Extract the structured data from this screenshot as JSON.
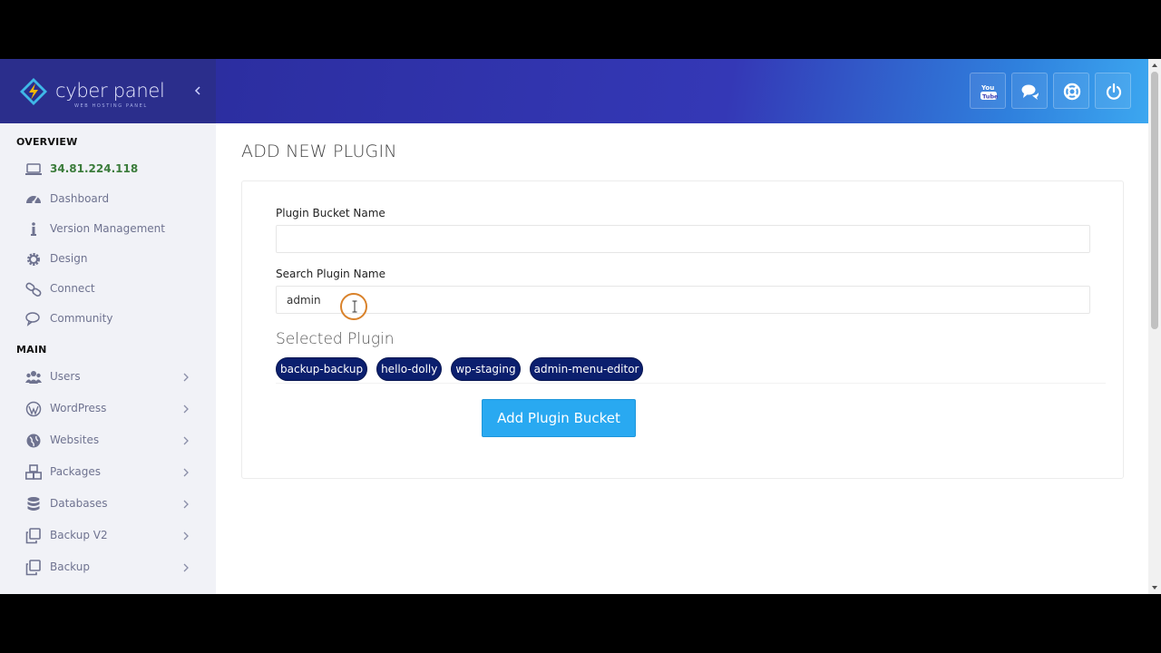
{
  "brand": {
    "name": "cyber panel",
    "tagline": "WEB HOSTING PANEL"
  },
  "sidebar": {
    "overview_title": "OVERVIEW",
    "overview_items": [
      {
        "label": "34.81.224.118",
        "icon": "monitor-icon"
      },
      {
        "label": "Dashboard",
        "icon": "dashboard-gauge-icon"
      },
      {
        "label": "Version Management",
        "icon": "info-icon"
      },
      {
        "label": "Design",
        "icon": "gear-icon"
      },
      {
        "label": "Connect",
        "icon": "link-icon"
      },
      {
        "label": "Community",
        "icon": "comments-icon"
      }
    ],
    "main_title": "MAIN",
    "main_items": [
      {
        "label": "Users",
        "icon": "users-icon"
      },
      {
        "label": "WordPress",
        "icon": "wordpress-icon"
      },
      {
        "label": "Websites",
        "icon": "globe-icon"
      },
      {
        "label": "Packages",
        "icon": "cubes-icon"
      },
      {
        "label": "Databases",
        "icon": "database-icon"
      },
      {
        "label": "Backup V2",
        "icon": "clone-icon"
      },
      {
        "label": "Backup",
        "icon": "clone-icon"
      }
    ]
  },
  "topbar": {
    "buttons": [
      "youtube-icon",
      "chat-icon",
      "lifebuoy-icon",
      "power-icon"
    ]
  },
  "main": {
    "page_title": "ADD NEW PLUGIN",
    "bucket_label": "Plugin Bucket Name",
    "bucket_value": "",
    "search_label": "Search Plugin Name",
    "search_value": "admin",
    "selected_title": "Selected Plugin",
    "selected_plugins": [
      "backup-backup",
      "hello-dolly",
      "wp-staging",
      "admin-menu-editor"
    ],
    "add_button": "Add Plugin Bucket"
  },
  "colors": {
    "brand_dark": "#2b2e8c",
    "topbar_end": "#3ca7f0",
    "chip": "#0b1f6e",
    "primary_button": "#29a9f1",
    "ip_text": "#3b7c3b"
  }
}
